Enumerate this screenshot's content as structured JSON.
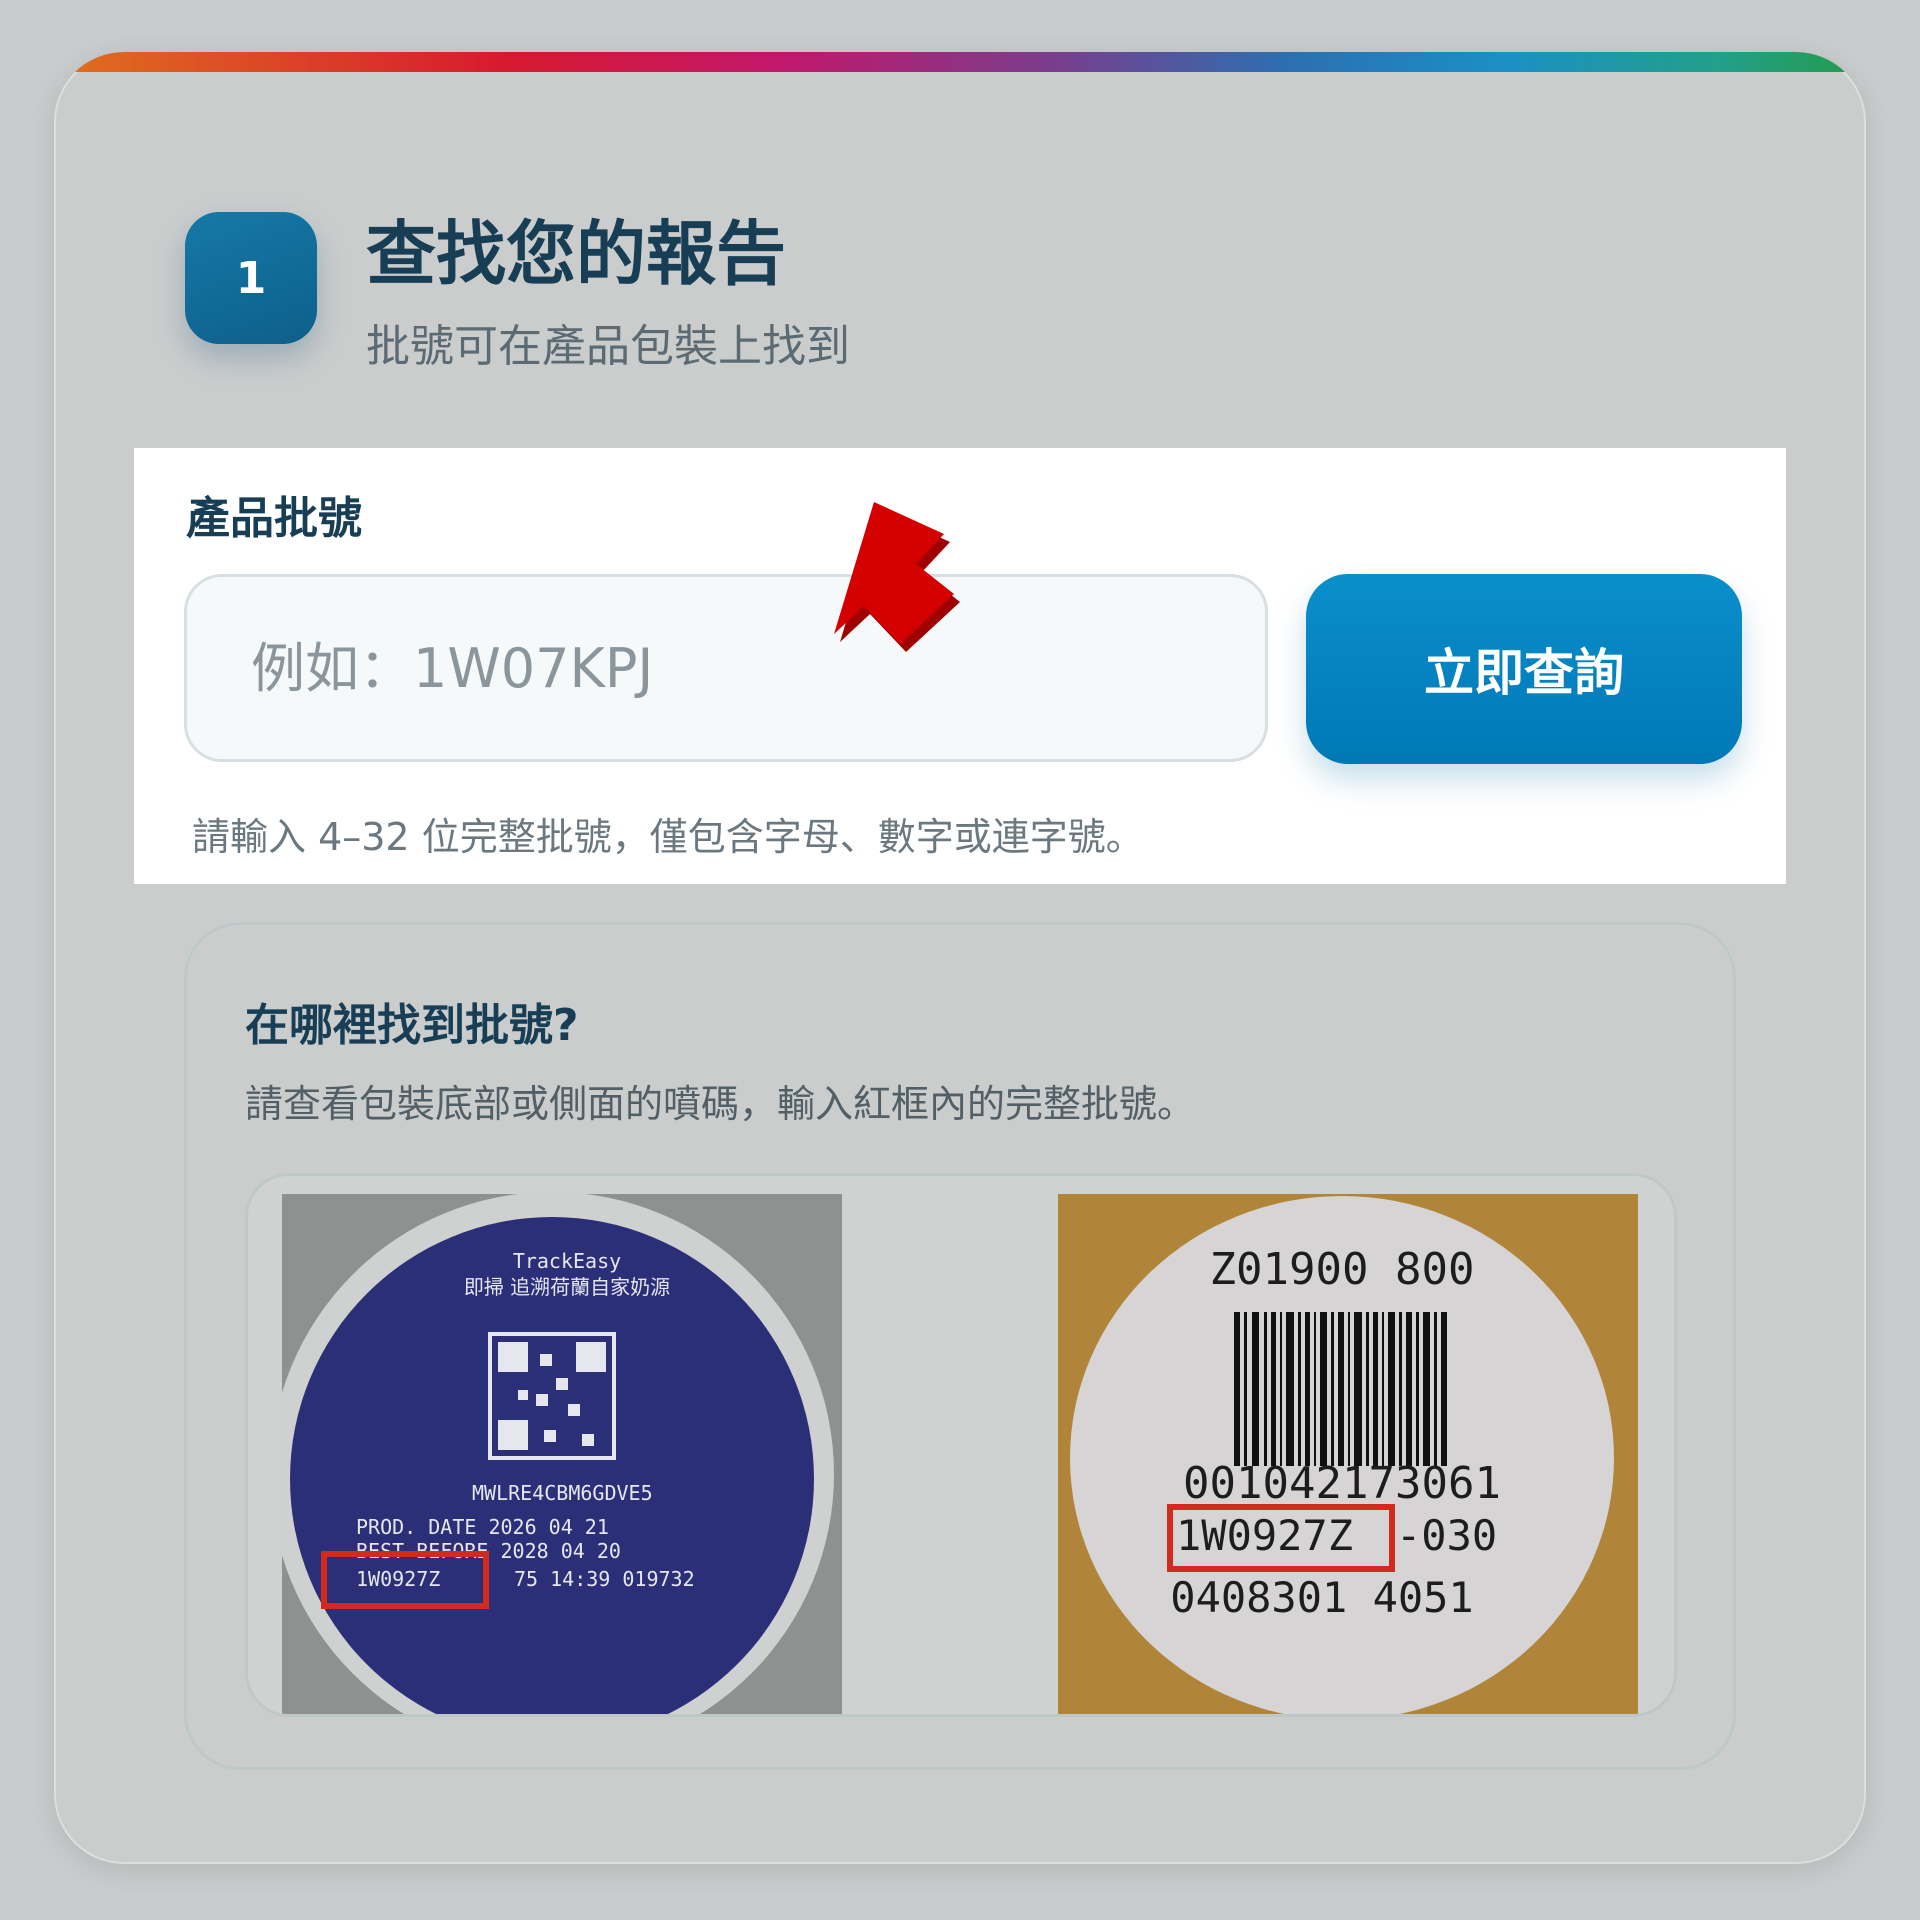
{
  "step": {
    "number": "1",
    "title": "查找您的報告",
    "subtitle": "批號可在產品包裝上找到"
  },
  "form": {
    "label": "產品批號",
    "placeholder": "例如：1W07KPJ",
    "button_label": "立即查詢",
    "hint": "請輸入 4–32 位完整批號，僅包含字母、數字或連字號。"
  },
  "help": {
    "title": "在哪裡找到批號?",
    "description": "請查看包裝底部或側面的噴碼，輸入紅框內的完整批號。",
    "can_label": {
      "brand": "TrackEasy",
      "tagline": "即掃 追溯荷蘭自家奶源",
      "code": "MWLRE4CBM6GDVE5",
      "prod_date": "PROD. DATE   2026 04 21",
      "best_before": "BEST BEFORE 2028 04 20",
      "batch": "1W0927Z",
      "trailing": "75 14:39   019732"
    },
    "sticker_label": {
      "top_code": "Z01900 800",
      "number": "001042173061",
      "batch": "1W0927Z",
      "batch_suffix": "-030",
      "bottom_code": "0408301 4051"
    }
  },
  "colors": {
    "accent": "#0a8fcb",
    "title": "#173e55",
    "highlight_box": "#d32a1f",
    "arrow": "#d40000"
  },
  "icons": {
    "pointer": "red-arrow-icon"
  }
}
